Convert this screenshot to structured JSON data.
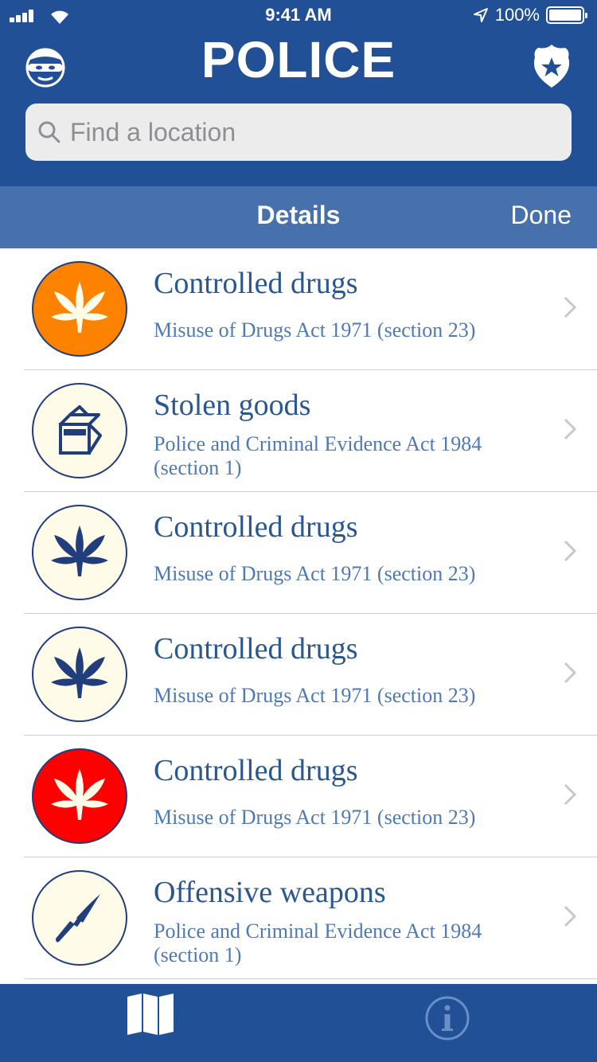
{
  "status_bar": {
    "time": "9:41 AM",
    "battery": "100%"
  },
  "header": {
    "title": "POLICE",
    "left_icon": "robber-mask-icon",
    "right_icon": "police-badge-icon"
  },
  "search": {
    "placeholder": "Find a location",
    "value": ""
  },
  "subnav": {
    "title": "Details",
    "done_label": "Done"
  },
  "list": {
    "items": [
      {
        "title": "Controlled drugs",
        "subtitle": "Misuse of Drugs Act 1971  (section 23)",
        "icon": "cannabis-leaf-icon",
        "badge_color": "#fd8200",
        "icon_color": "#fffbe9"
      },
      {
        "title": "Stolen goods",
        "subtitle": "Police and Criminal Evidence Act 1984 (section 1)",
        "icon": "open-box-icon",
        "badge_color": "#fffbe9",
        "icon_color": "#213d7c"
      },
      {
        "title": "Controlled drugs",
        "subtitle": "Misuse of Drugs Act 1971  (section 23)",
        "icon": "cannabis-leaf-icon",
        "badge_color": "#fffbe9",
        "icon_color": "#213d7c"
      },
      {
        "title": "Controlled drugs",
        "subtitle": "Misuse of Drugs Act 1971  (section 23)",
        "icon": "cannabis-leaf-icon",
        "badge_color": "#fffbe9",
        "icon_color": "#213d7c"
      },
      {
        "title": "Controlled drugs",
        "subtitle": "Misuse of Drugs Act 1971  (section 23)",
        "icon": "cannabis-leaf-icon",
        "badge_color": "#fe0000",
        "icon_color": "#fffbe9"
      },
      {
        "title": "Offensive weapons",
        "subtitle": "Police and Criminal Evidence Act 1984 (section 1)",
        "icon": "knife-icon",
        "badge_color": "#fffbe9",
        "icon_color": "#213d7c"
      }
    ]
  },
  "tabbar": {
    "tabs": [
      {
        "icon": "map-icon",
        "active": true
      },
      {
        "icon": "info-icon",
        "active": false
      }
    ]
  },
  "colors": {
    "brand": "#215097",
    "subbar": "#4671ac",
    "title_text": "#2a5790",
    "subtitle_text": "#4d79b5"
  }
}
